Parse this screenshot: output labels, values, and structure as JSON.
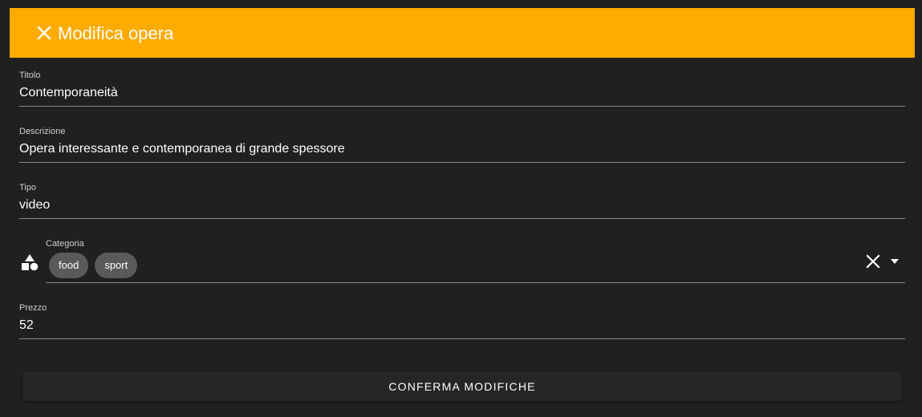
{
  "header": {
    "title": "Modifica opera",
    "close_icon": "close-icon",
    "background_color": "#ffab00"
  },
  "form": {
    "titolo": {
      "label": "Titolo",
      "value": "Contemporaneità"
    },
    "descrizione": {
      "label": "Descrizione",
      "value": "Opera interessante e contemporanea di grande spessore"
    },
    "tipo": {
      "label": "Tipo",
      "value": "video"
    },
    "categoria": {
      "label": "Categoria",
      "icon": "shapes-icon",
      "chips": [
        "food",
        "sport"
      ]
    },
    "prezzo": {
      "label": "Prezzo",
      "value": "52"
    }
  },
  "actions": {
    "confirm_label": "CONFERMA MODIFICHE"
  }
}
